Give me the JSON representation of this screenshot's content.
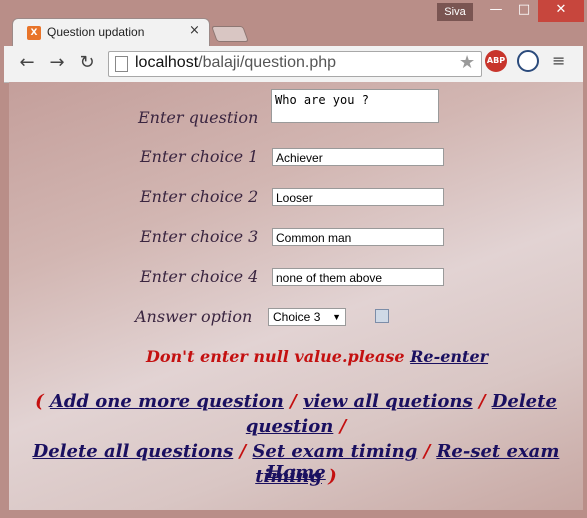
{
  "window": {
    "user": "Siva",
    "minimize": "—",
    "maximize": "□",
    "close": "✕"
  },
  "tab": {
    "title": "Question updation",
    "close": "×"
  },
  "toolbar": {
    "back": "←",
    "forward": "→",
    "reload": "↻",
    "url_host": "localhost",
    "url_path": "/balaji/question.php",
    "star": "★",
    "abp": "ABP",
    "menu": "≡"
  },
  "form": {
    "question_label": "Enter question",
    "question_value": "Who are you ?",
    "choice1_label": "Enter choice 1",
    "choice1_value": "Achiever",
    "choice2_label": "Enter choice 2",
    "choice2_value": "Looser",
    "choice3_label": "Enter choice 3",
    "choice3_value": "Common man",
    "choice4_label": "Enter choice 4",
    "choice4_value": "none of them above",
    "answer_label": "Answer option",
    "answer_value": "Choice 3",
    "answer_arrow": "▼"
  },
  "message": {
    "error": "Don't enter null value.please",
    "reenter": "Re-enter"
  },
  "links": {
    "open": "(",
    "add_more": "Add one more question",
    "view_all": "view all quetions",
    "delete": "Delete question",
    "delete_all": "Delete all questions",
    "set_timing": "Set exam timing",
    "reset_timing": "Re-set exam timing",
    "close": ")",
    "slash": "/",
    "home": "Home"
  }
}
